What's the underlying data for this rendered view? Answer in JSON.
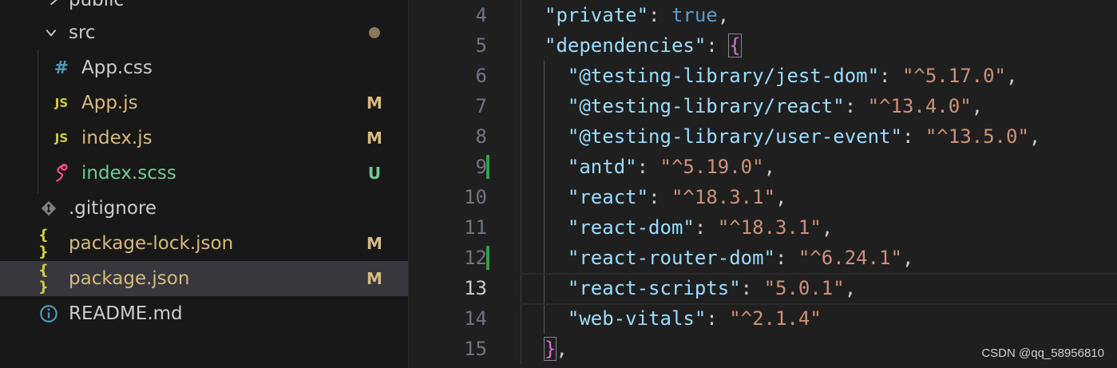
{
  "explorer": {
    "items": [
      {
        "name": "public",
        "badge": ""
      },
      {
        "name": "src",
        "badge": ""
      },
      {
        "name": "App.css",
        "badge": ""
      },
      {
        "name": "App.js",
        "badge": "M"
      },
      {
        "name": "index.js",
        "badge": "M"
      },
      {
        "name": "index.scss",
        "badge": "U"
      },
      {
        "name": ".gitignore",
        "badge": ""
      },
      {
        "name": "package-lock.json",
        "badge": "M"
      },
      {
        "name": "package.json",
        "badge": "M"
      },
      {
        "name": "README.md",
        "badge": ""
      }
    ],
    "icons": {
      "css": "#",
      "js": "JS",
      "json": "{ }"
    }
  },
  "colors": {
    "modified": "#d7ba7d",
    "untracked": "#73c991",
    "git_added": "#2ea043"
  },
  "editor": {
    "lines": [
      {
        "no": "4",
        "key": "\"private\"",
        "value": "true"
      },
      {
        "no": "5",
        "key": "\"dependencies\"",
        "value": "{"
      },
      {
        "no": "6",
        "key": "\"@testing-library/jest-dom\"",
        "value": "\"^5.17.0\""
      },
      {
        "no": "7",
        "key": "\"@testing-library/react\"",
        "value": "\"^13.4.0\""
      },
      {
        "no": "8",
        "key": "\"@testing-library/user-event\"",
        "value": "\"^13.5.0\""
      },
      {
        "no": "9",
        "key": "\"antd\"",
        "value": "\"^5.19.0\""
      },
      {
        "no": "10",
        "key": "\"react\"",
        "value": "\"^18.3.1\""
      },
      {
        "no": "11",
        "key": "\"react-dom\"",
        "value": "\"^18.3.1\""
      },
      {
        "no": "12",
        "key": "\"react-router-dom\"",
        "value": "\"^6.24.1\""
      },
      {
        "no": "13",
        "key": "\"react-scripts\"",
        "value": "\"5.0.1\""
      },
      {
        "no": "14",
        "key": "\"web-vitals\"",
        "value": "\"^2.1.4\""
      },
      {
        "no": "15",
        "key": "}",
        "value": ","
      }
    ]
  },
  "watermark": "CSDN @qq_58956810"
}
